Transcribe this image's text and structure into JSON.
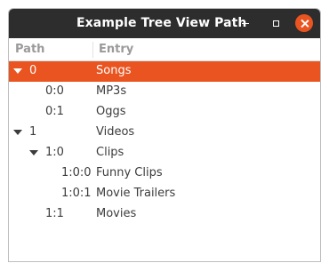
{
  "window": {
    "title": "Example Tree View Path"
  },
  "columns": {
    "path": "Path",
    "entry": "Entry"
  },
  "rows": [
    {
      "path": "0",
      "entry": "Songs",
      "expanded": true,
      "selected": true
    },
    {
      "path": "0:0",
      "entry": "MP3s"
    },
    {
      "path": "0:1",
      "entry": "Oggs"
    },
    {
      "path": "1",
      "entry": "Videos",
      "expanded": true
    },
    {
      "path": "1:0",
      "entry": "Clips",
      "expanded": true
    },
    {
      "path": "1:0:0",
      "entry": "Funny Clips"
    },
    {
      "path": "1:0:1",
      "entry": "Movie Trailers"
    },
    {
      "path": "1:1",
      "entry": "Movies"
    }
  ],
  "colors": {
    "selection": "#e95420",
    "titlebar": "#2d2d2d",
    "close_button": "#e95420"
  },
  "icons": {
    "minimize": "minimize-icon",
    "maximize": "maximize-icon",
    "close": "close-icon",
    "expander": "expander-triangle-down-icon"
  }
}
